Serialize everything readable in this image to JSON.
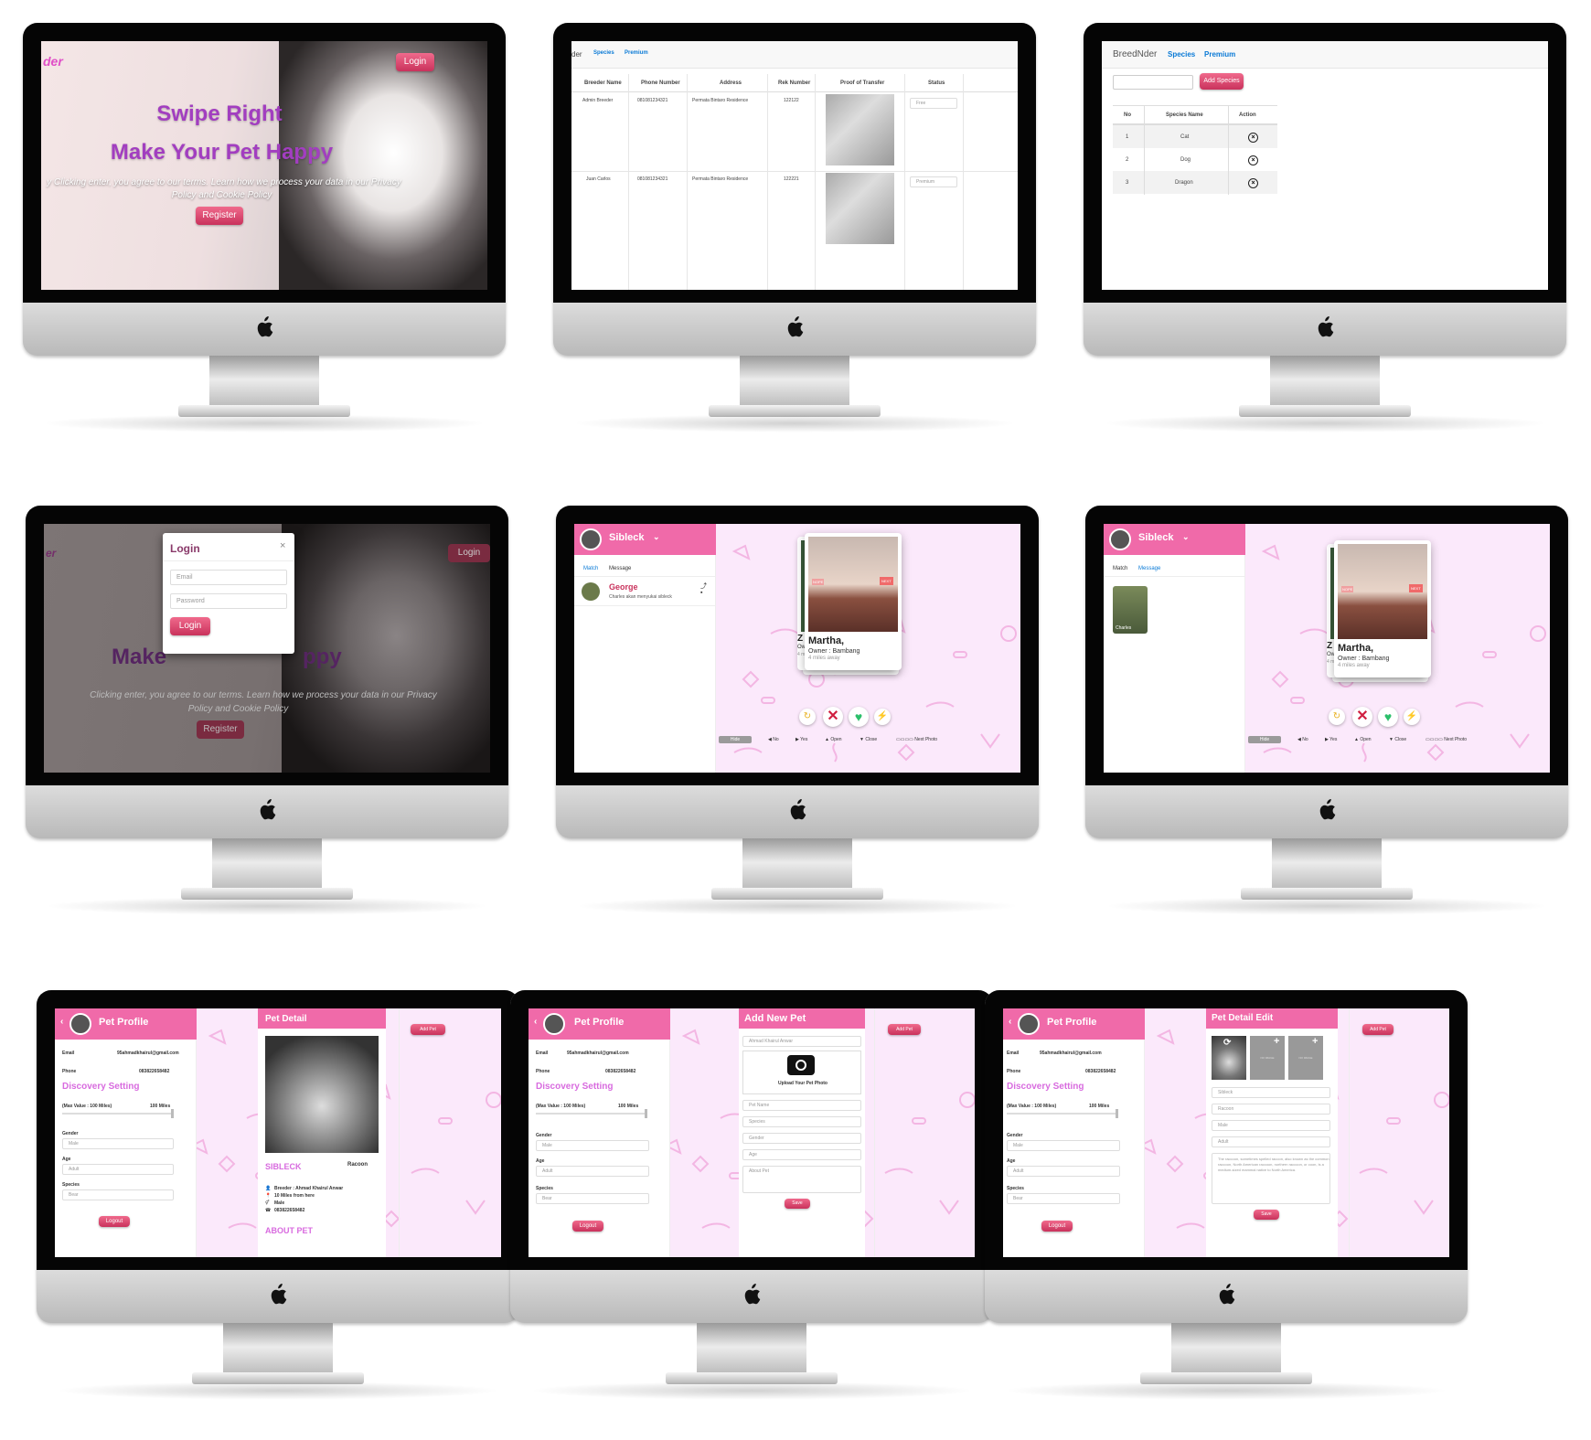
{
  "landing": {
    "brand": "der",
    "login": "Login",
    "title1": "Swipe Right",
    "title2": "Make Your Pet Happy",
    "terms1": "y Clicking enter, you agree to our terms. Learn how we process your data in our Privacy",
    "terms2": "Policy and Cookie Policy",
    "register": "Register"
  },
  "premium": {
    "brand": "der",
    "nav": [
      "Species",
      "Premium"
    ],
    "headers": [
      "Breeder Name",
      "Phone Number",
      "Address",
      "Rek Number",
      "Proof of Transfer",
      "Status"
    ],
    "rows": [
      {
        "name": "Admin Breeder",
        "phone": "081081234321",
        "address": "Permata Bintaro Residence",
        "rek": "122122",
        "status": "Free"
      },
      {
        "name": "Juan Carlos",
        "phone": "081081234321",
        "address": "Permata Bintaro Residence",
        "rek": "122221",
        "status": "Premium"
      }
    ]
  },
  "species": {
    "brand": "BreedNder",
    "nav": [
      "Species",
      "Premium"
    ],
    "add": "Add Species",
    "headers": [
      "No",
      "Species Name",
      "Action"
    ],
    "rows": [
      {
        "no": "1",
        "name": "Cat"
      },
      {
        "no": "2",
        "name": "Dog"
      },
      {
        "no": "3",
        "name": "Dragon"
      }
    ]
  },
  "loginModal": {
    "brand": "er",
    "title": "Login",
    "close": "×",
    "email": "Email",
    "password": "Password",
    "button": "Login",
    "bgLogin": "Login",
    "bgTitle": "Make",
    "bgTitleEnd": "ppy",
    "terms1": "Clicking enter, you agree to our terms. Learn how we process your data in our Privacy",
    "terms2": "Policy and Cookie Policy",
    "register": "Register"
  },
  "swipe": {
    "user": "Sibleck",
    "tabs": [
      "Match",
      "Message"
    ],
    "msg": {
      "name": "George",
      "text": "Charles akan menyukai sibleck"
    },
    "matchName": "Charles",
    "card": {
      "name": "Martha,",
      "owner": "Owner : Bambang",
      "distance": "4 miles away",
      "nope": "NOPE",
      "next": "NEXT",
      "behindName": "Z",
      "behindOwner": "Ow",
      "behindDist": "4 m"
    },
    "controls": {
      "hide": "Hide",
      "no": "No",
      "yes": "Yes",
      "open": "Open",
      "close": "Close",
      "next": "Next Photo"
    }
  },
  "profile": {
    "title": "Pet Profile",
    "emailLabel": "Email",
    "email": "95ahmadkhairul@gmail.com",
    "phoneLabel": "Phone",
    "phone": "083822658482",
    "discovery": "Discovery Setting",
    "maxLabel": "(Max Value : 100 Miles)",
    "maxValue": "100 Miles",
    "genderLabel": "Gender",
    "gender": "Male",
    "ageLabel": "Age",
    "age": "Adult",
    "speciesLabel": "Species",
    "species": "Bear",
    "logout": "Logout"
  },
  "petDetail": {
    "title": "Pet Detail",
    "addPet": "Add Pet",
    "name": "SIBLECK",
    "species": "Racoon",
    "breeder": "Breeder : Ahmad Khairul Anwar",
    "distance": "10 Miles from here",
    "gender": "Male",
    "phone": "083822658482",
    "about": "ABOUT PET"
  },
  "addPet": {
    "title": "Add New Pet",
    "addPet": "Add Pet",
    "owner": "Ahmad Khairul Anwar",
    "upload": "Upload Your Pet Photo",
    "petName": "Pet Name",
    "species": "Species",
    "gender": "Gender",
    "age": "Age",
    "about": "About Pet",
    "save": "Save"
  },
  "editPet": {
    "title": "Pet Detail Edit",
    "addPet": "Add Pet",
    "noImage": "NO IMAGE",
    "name": "Sibleck",
    "species": "Racoon",
    "gender": "Male",
    "age": "Adult",
    "about": "The raccoon, sometimes spelled racoon, also known as the common raccoon, North American raccoon, northern raccoon, or coon, is a medium-sized mammal native to North America.",
    "save": "Save"
  },
  "colors": {
    "pink": "#f06aa9",
    "accent": "#c9325c",
    "purple": "#9b3fbf",
    "link": "#0a7ad6"
  }
}
